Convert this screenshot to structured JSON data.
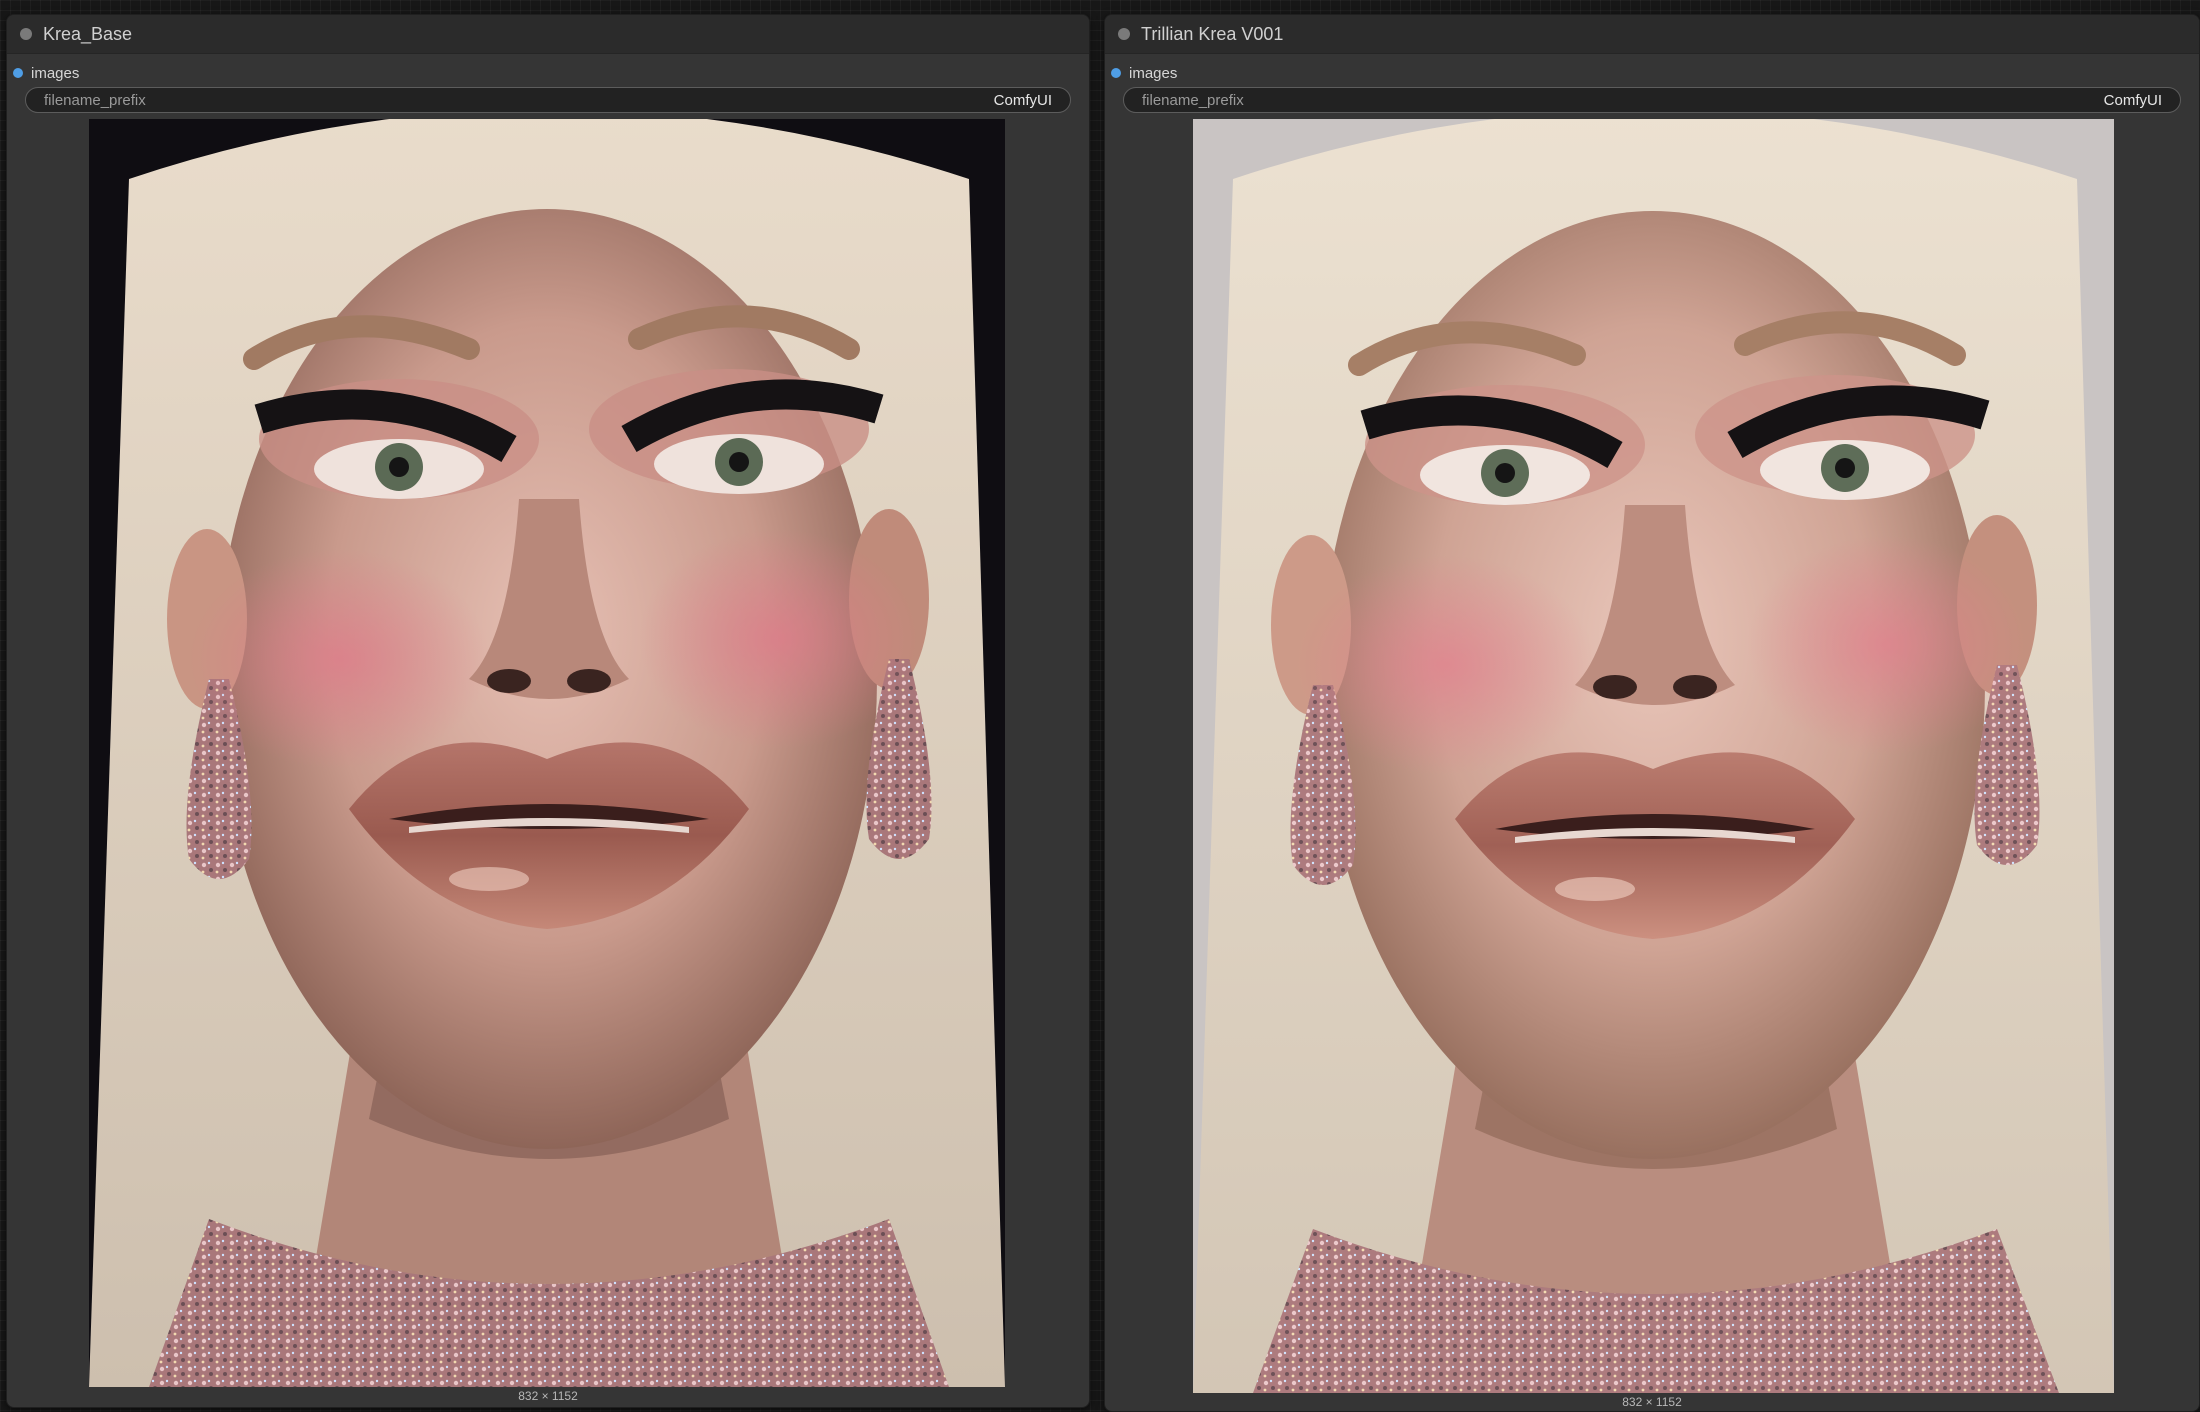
{
  "colors": {
    "canvas_bg": "#171717",
    "node_bg": "#353535",
    "header_bg": "#2b2b2b",
    "slot_dot": "#4f9ee6",
    "status_dot": "#7a7a7a"
  },
  "nodes": [
    {
      "title": "Krea_Base",
      "slot_label": "images",
      "widget": {
        "name": "filename_prefix",
        "value": "ComfyUI"
      },
      "dimensions": "832 × 1152",
      "preview_bg": "#0f0d12"
    },
    {
      "title": "Trillian Krea V001",
      "slot_label": "images",
      "widget": {
        "name": "filename_prefix",
        "value": "ComfyUI"
      },
      "dimensions": "832 × 1152",
      "preview_bg": "#c9c4c3"
    }
  ]
}
